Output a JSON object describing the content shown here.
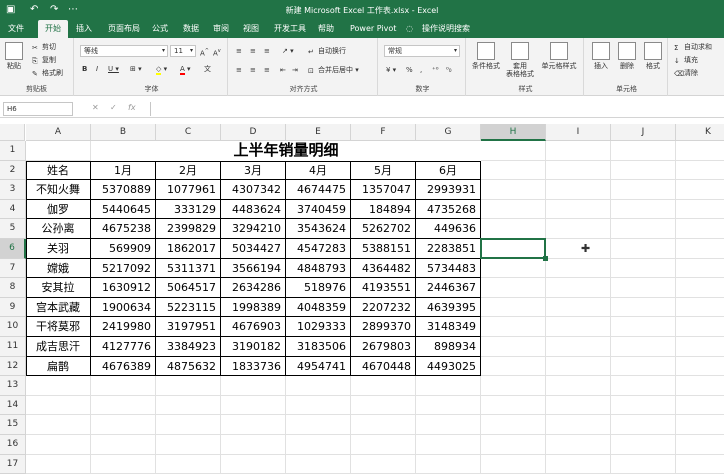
{
  "window": {
    "document_title": "新建 Microsoft Excel 工作表.xlsx - Excel"
  },
  "tabs": [
    "文件",
    "开始",
    "插入",
    "页面布局",
    "公式",
    "数据",
    "审阅",
    "视图",
    "开发工具",
    "帮助",
    "Power Pivot",
    "操作说明搜索"
  ],
  "active_tab": "开始",
  "ribbon": {
    "clipboard": {
      "paste": "粘贴",
      "cut": "剪切",
      "copy": "复制",
      "format_painter": "格式刷",
      "label": "剪贴板"
    },
    "font": {
      "font_name": "等线",
      "font_size": "11",
      "label": "字体"
    },
    "alignment": {
      "wrap": "自动换行",
      "merge": "合并后居中",
      "label": "对齐方式"
    },
    "number": {
      "format": "常规",
      "label": "数字"
    },
    "styles": {
      "conditional": "条件格式",
      "table": "套用\n表格格式",
      "cell_styles": "单元格样式",
      "label": "样式"
    },
    "cells": {
      "insert": "插入",
      "delete": "删除",
      "format": "格式",
      "label": "单元格"
    },
    "editing": {
      "autosum": "自动求和",
      "fill": "填充",
      "clear": "清除"
    }
  },
  "formula_bar": {
    "name_box": "H6",
    "formula": ""
  },
  "sheet": {
    "columns": [
      "A",
      "B",
      "C",
      "D",
      "E",
      "F",
      "G",
      "H",
      "I",
      "J",
      "K"
    ],
    "rows": [
      "1",
      "2",
      "3",
      "4",
      "5",
      "6",
      "7",
      "8",
      "9",
      "10",
      "11",
      "12",
      "13",
      "14",
      "15",
      "16",
      "17"
    ],
    "title": "上半年销量明细",
    "headers": [
      "姓名",
      "1月",
      "2月",
      "3月",
      "4月",
      "5月",
      "6月"
    ],
    "data": [
      [
        "不知火舞",
        "5370889",
        "1077961",
        "4307342",
        "4674475",
        "1357047",
        "2993931"
      ],
      [
        "伽罗",
        "5440645",
        "333129",
        "4483624",
        "3740459",
        "184894",
        "4735268"
      ],
      [
        "公孙离",
        "4675238",
        "2399829",
        "3294210",
        "3543624",
        "5262702",
        "449636"
      ],
      [
        "关羽",
        "569909",
        "1862017",
        "5034427",
        "4547283",
        "5388151",
        "2283851"
      ],
      [
        "嫦娥",
        "5217092",
        "5311371",
        "3566194",
        "4848793",
        "4364482",
        "5734483"
      ],
      [
        "安其拉",
        "1630912",
        "5064517",
        "2634286",
        "518976",
        "4193551",
        "2446367"
      ],
      [
        "宫本武藏",
        "1900634",
        "5223115",
        "1998389",
        "4048359",
        "2207232",
        "4639395"
      ],
      [
        "干将莫邪",
        "2419980",
        "3197951",
        "4676903",
        "1029333",
        "2899370",
        "3148349"
      ],
      [
        "成吉思汗",
        "4127776",
        "3384923",
        "3190182",
        "3183506",
        "2679803",
        "898934"
      ],
      [
        "扁鹊",
        "4676389",
        "4875632",
        "1833736",
        "4954741",
        "4670448",
        "4493025"
      ]
    ],
    "selected_cell": "H6"
  }
}
